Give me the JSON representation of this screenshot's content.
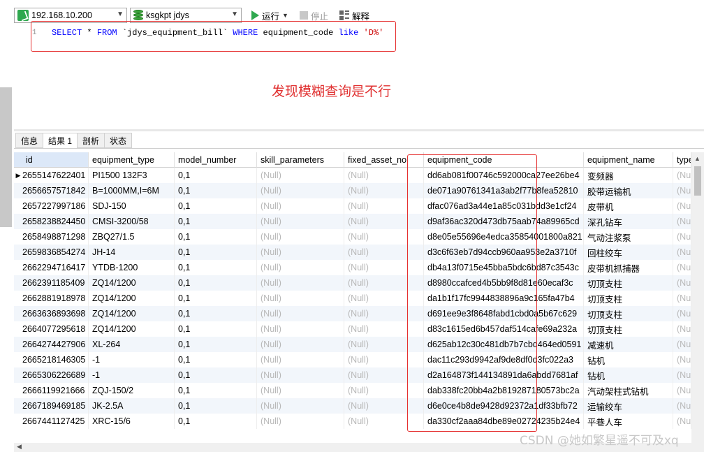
{
  "toolbar": {
    "connection": "192.168.10.200",
    "database": "ksgkpt jdys",
    "run_label": "运行",
    "stop_label": "停止",
    "explain_label": "解释"
  },
  "editor": {
    "line_number": "1",
    "sql_select": "SELECT",
    "sql_star": " * ",
    "sql_from": "FROM",
    "sql_table": " `jdys_equipment_bill` ",
    "sql_where": "WHERE",
    "sql_column": " equipment_code ",
    "sql_like": "like",
    "sql_pattern": " 'D%'",
    "annotation": "发现模糊查询是不行"
  },
  "tabs": [
    "信息",
    "结果 1",
    "剖析",
    "状态"
  ],
  "grid": {
    "columns": [
      "id",
      "equipment_type",
      "model_number",
      "skill_parameters",
      "fixed_asset_no",
      "equipment_code",
      "equipment_name",
      "type"
    ],
    "rows": [
      [
        "2655147622401",
        "PI1500 132F3",
        "0,1",
        "(Null)",
        "(Null)",
        "dd6ab081f00746c592000ca27ee26be4",
        "变频器",
        "(Nu"
      ],
      [
        "2656657571842",
        "B=1000MM,I=6M",
        "0,1",
        "(Null)",
        "(Null)",
        "de071a90761341a3ab2f77b8fea52810",
        "胶带运输机",
        "(Nu"
      ],
      [
        "2657227997186",
        "SDJ-150",
        "0,1",
        "(Null)",
        "(Null)",
        "dfac076ad3a44e1a85c031bdd3e1cf24",
        "皮带机",
        "(Nu"
      ],
      [
        "2658238824450",
        "CMSI-3200/58",
        "0,1",
        "(Null)",
        "(Null)",
        "d9af36ac320d473db75aab74a89965cd",
        "深孔钻车",
        "(Nu"
      ],
      [
        "2658498871298",
        "ZBQ27/1.5",
        "0,1",
        "(Null)",
        "(Null)",
        "d8e05e55696e4edca35854001800a821",
        "气动注浆泵",
        "(Nu"
      ],
      [
        "2659836854274",
        "JH-14",
        "0,1",
        "(Null)",
        "(Null)",
        "d3c6f63eb7d94ccb960aa953e2a3710f",
        "回柱绞车",
        "(Nu"
      ],
      [
        "2662294716417",
        "YTDB-1200",
        "0,1",
        "(Null)",
        "(Null)",
        "db4a13f0715e45bba5bdc6bd87c3543c",
        "皮带机抓捕器",
        "(Nu"
      ],
      [
        "2662391185409",
        "ZQ14/1200",
        "0,1",
        "(Null)",
        "(Null)",
        "d8980ccafced4b5bb9f8d81e60ecaf3c",
        "切顶支柱",
        "(Nu"
      ],
      [
        "2662881918978",
        "ZQ14/1200",
        "0,1",
        "(Null)",
        "(Null)",
        "da1b1f17fc9944838896a9c165fa47b4",
        "切顶支柱",
        "(Nu"
      ],
      [
        "2663636893698",
        "ZQ14/1200",
        "0,1",
        "(Null)",
        "(Null)",
        "d691ee9e3f8648fabd1cbd0a5b67c629",
        "切顶支柱",
        "(Nu"
      ],
      [
        "2664077295618",
        "ZQ14/1200",
        "0,1",
        "(Null)",
        "(Null)",
        "d83c1615ed6b457daf514cafe69a232a",
        "切顶支柱",
        "(Nu"
      ],
      [
        "2664274427906",
        "XL-264",
        "0,1",
        "(Null)",
        "(Null)",
        "d625ab12c30c481db7b7cbd464ed0591",
        "减速机",
        "(Nu"
      ],
      [
        "2665218146305",
        "-1",
        "0,1",
        "(Null)",
        "(Null)",
        "dac11c293d9942af9de8df0d3fc022a3",
        "钻机",
        "(Nu"
      ],
      [
        "2665306226689",
        "-1",
        "0,1",
        "(Null)",
        "(Null)",
        "d2a164873f144134891da6abdd7681af",
        "钻机",
        "(Nu"
      ],
      [
        "2666119921666",
        "ZQJ-150/2",
        "0,1",
        "(Null)",
        "(Null)",
        "dab338fc20bb4a2b819287180573bc2a",
        "汽动架柱式钻机",
        "(Nu"
      ],
      [
        "2667189469185",
        "JK-2.5A",
        "0,1",
        "(Null)",
        "(Null)",
        "d6e0ce4b8de9428d92372a1df33bfb72",
        "运输绞车",
        "(Nu"
      ],
      [
        "2667441127425",
        "XRC-15/6",
        "0,1",
        "(Null)",
        "(Null)",
        "da330cf2aaa84dbe89e02724235b24e4",
        "平巷人车",
        "(Nu"
      ]
    ]
  },
  "watermark": "CSDN @她如繁星遥不可及xq",
  "colors": {
    "accent_red": "#e53030",
    "run_green": "#2fa84f",
    "null_gray": "#b8b8b8"
  }
}
